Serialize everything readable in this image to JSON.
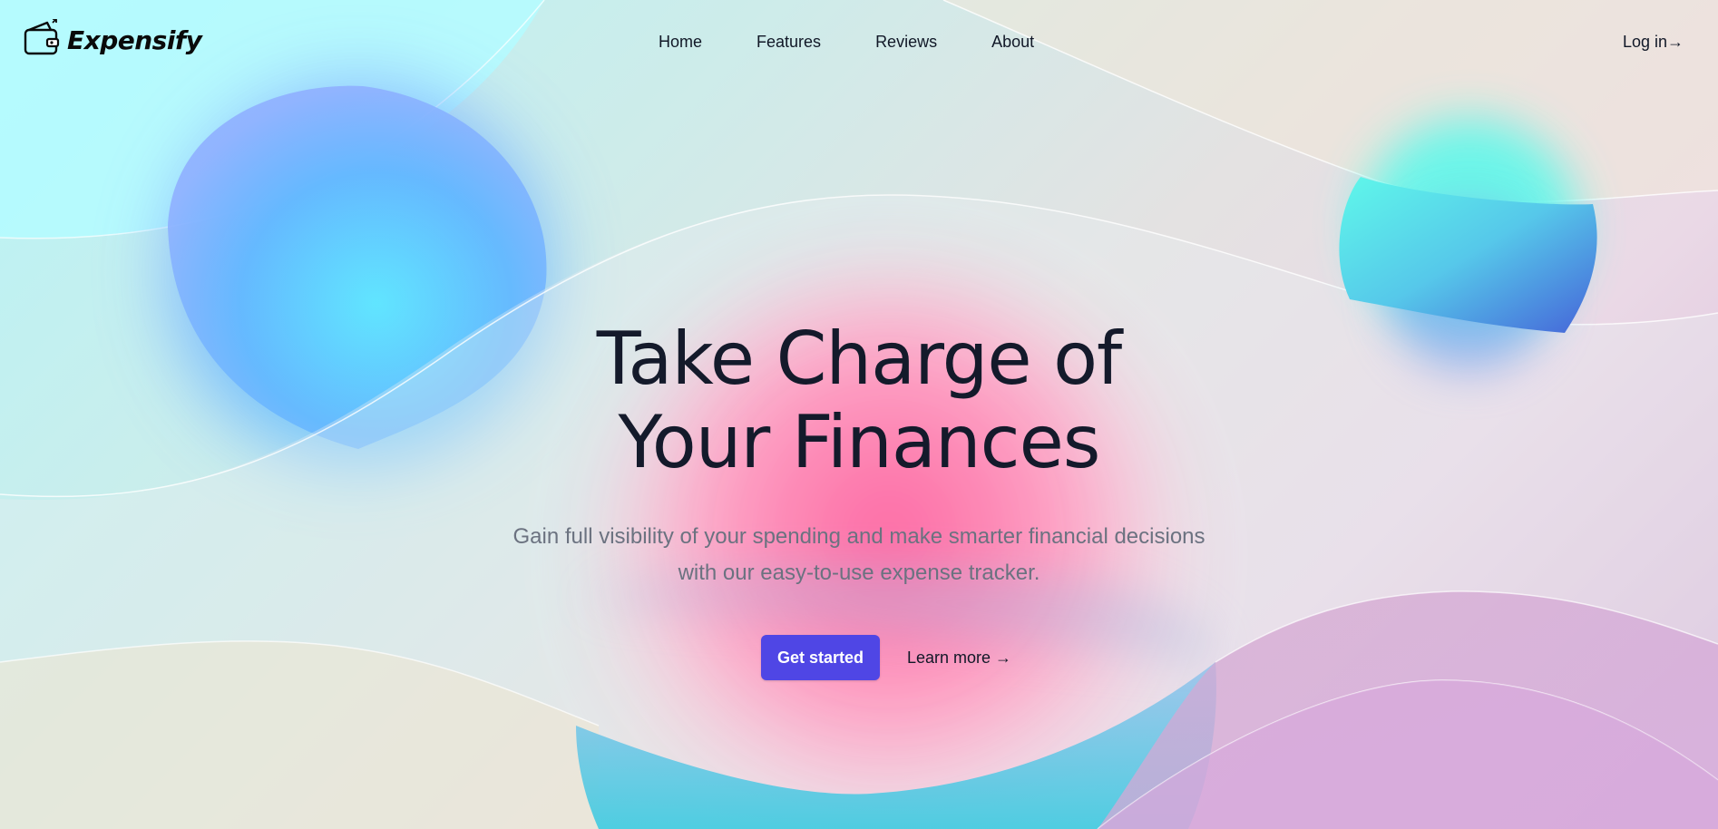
{
  "brand": {
    "name": "Expensify",
    "icon": "wallet-icon"
  },
  "nav": {
    "links": [
      {
        "label": "Home"
      },
      {
        "label": "Features"
      },
      {
        "label": "Reviews"
      },
      {
        "label": "About"
      }
    ],
    "login_label": "Log in→"
  },
  "hero": {
    "title_line1": "Take Charge of",
    "title_line2": "Your Finances",
    "subtitle_line1": "Gain full visibility of your spending and make smarter financial decisions",
    "subtitle_line2": "with our easy-to-use expense tracker.",
    "primary_cta": "Get started",
    "secondary_cta": "Learn more →"
  },
  "colors": {
    "accent": "#4f46e5",
    "heading": "#141a2b",
    "subtext": "#6b7280"
  }
}
